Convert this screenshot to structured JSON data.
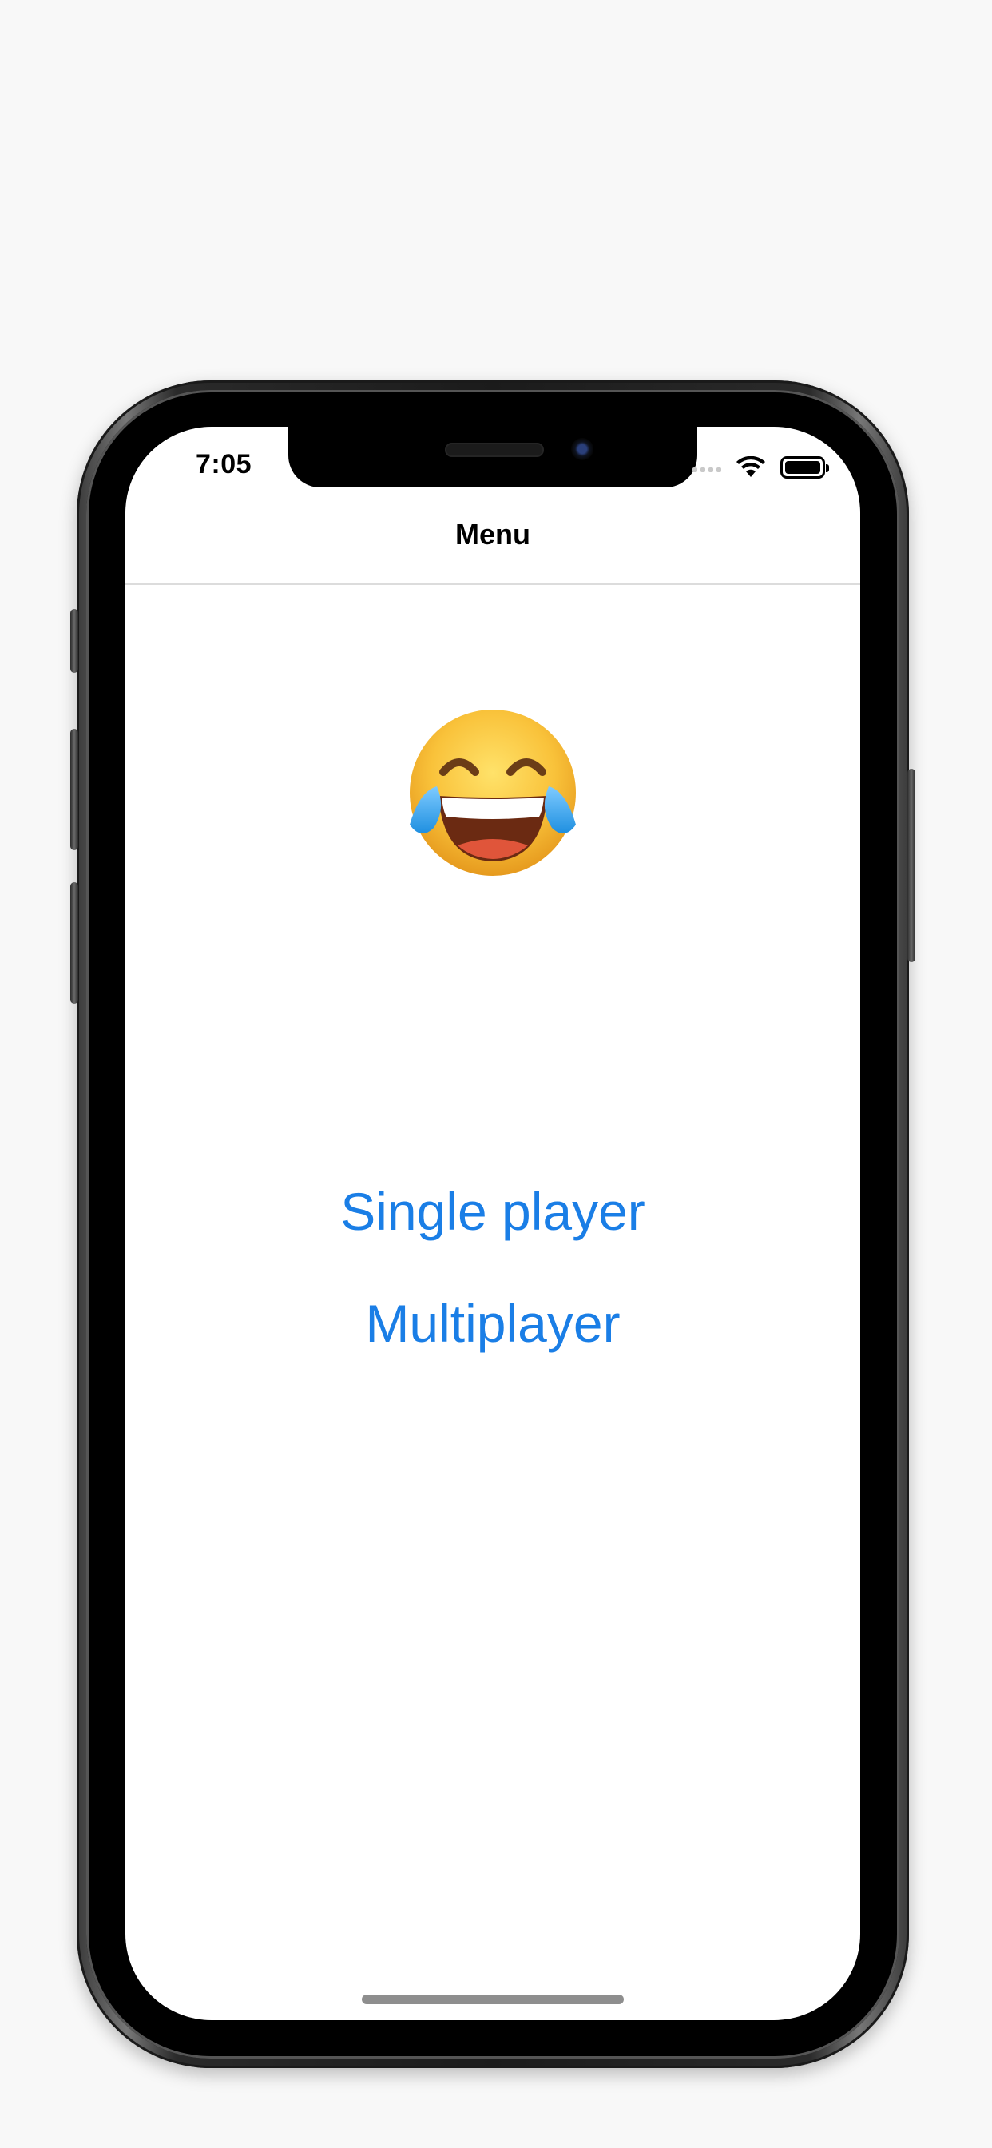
{
  "status_bar": {
    "time": "7:05",
    "icons": [
      "signal-icon",
      "wifi-icon",
      "battery-icon"
    ]
  },
  "nav": {
    "title": "Menu"
  },
  "content": {
    "emoji": "face-with-tears-of-joy",
    "buttons": {
      "single_player": "Single player",
      "multiplayer": "Multiplayer"
    }
  },
  "colors": {
    "accent": "#1a7ee6",
    "background": "#ffffff",
    "nav_border": "#dcdcdc"
  }
}
